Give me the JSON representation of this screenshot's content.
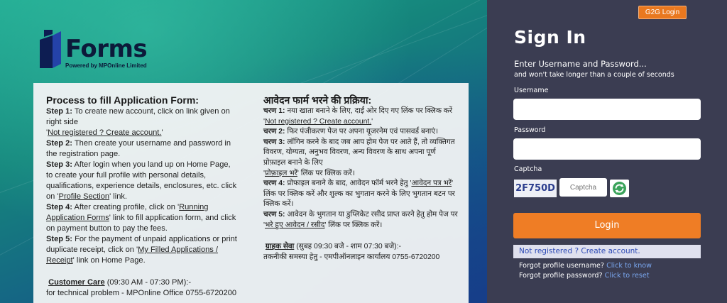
{
  "logo": {
    "text": "Forms",
    "tagline": "Powered by MPOnline Limited"
  },
  "colors": {
    "accent": "#ef7d25",
    "panel": "#3b3d52",
    "link": "#2c49b5"
  },
  "english": {
    "title": "Process to fill Application Form:",
    "step1_label": "Step 1:",
    "step1_text": " To create new account, click on link given on right side",
    "step1_link": "Not registered ? Create account.",
    "step2_label": "Step 2:",
    "step2_text": " Then create your username and password in the registration page.",
    "step3_label": "Step 3:",
    "step3_text": " After login when you land up on Home Page, to create your full profile with personal details, qualifications, experience details, enclosures, etc. click on ",
    "step3_link": "Profile Section",
    "step3_tail": " link.",
    "step4_label": "Step 4:",
    "step4_text": " After creating profile, click on ",
    "step4_link": "Running Application Forms",
    "step4_tail": " link to fill application form, and click on payment button to pay the fees.",
    "step5_label": "Step 5:",
    "step5_text": " For the payment of unpaid applications or print duplicate receipt, click on ",
    "step5_link": "My Filled Applications / Receipt",
    "step5_tail": " link on Home Page.",
    "care_title": "Customer Care",
    "care_hours": " (09:30 AM - 07:30 PM):-",
    "care_text": "for technical problem - MPOnline Office 0755-6720200"
  },
  "hindi": {
    "title": "आवेदन फार्म भरने की प्रक्रिया:",
    "s1_label": "चरण 1:",
    "s1_text": " नया खाता बनाने के लिए, दाईं ओर दिए गए लिंक पर क्लिक करें",
    "s1_link": "Not registered ? Create account.",
    "s2_label": "चरण 2:",
    "s2_text": " फिर पंजीकरण पेज पर अपना यूजरनेम एवं पासवर्ड बनाएं।",
    "s3_label": "चरण 3:",
    "s3_text": " लॉगिन करने के बाद जब आप होम पेज पर आते हैं, तो व्यक्तिगत विवरण, योग्यता, अनुभव विवरण, अन्य विवरण के साथ अपना पूर्ण प्रोफ़ाइल बनाने के लिए",
    "s3_link": "प्रोफ़ाइल भरें",
    "s3_tail": "' लिंक पर क्लिक करें।",
    "s4_label": "चरण 4:",
    "s4_text": " प्रोफाइल बनाने के बाद, आवेदन फॉर्म भरने हेतु '",
    "s4_link": "आवेदन पत्र भरें",
    "s4_tail": "' लिंक पर क्लिक करें और शुल्क का भुगतान करने के लिए भुगतान बटन पर क्लिक करें।",
    "s5_label": "चरण 5:",
    "s5_text": " आवेदन के भुगतान या डुप्लिकेट रसीद प्राप्त करने हेतु होम पेज पर",
    "s5_link": "भरे हुए आवेदन / रसीद",
    "s5_tail": "' लिंक पर क्लिक करें।",
    "care_title": "ग्राहक सेवा",
    "care_hours": " (सुबह 09:30 बजे - शाम 07:30 बजे):-",
    "care_text": "तकनीकी समस्या हेतु - एमपीऑनलाइन कार्यालय 0755-6720200"
  },
  "signin": {
    "g2g_label": "G2G Login",
    "title": "Sign In",
    "subtitle": "Enter Username and Password...",
    "subtitle2": "and won't take longer than a couple of seconds",
    "username_label": "Username",
    "username_value": "",
    "password_label": "Password",
    "password_value": "",
    "captcha_label": "Captcha",
    "captcha_code": "2F750D",
    "captcha_placeholder": "Captcha",
    "login_label": "Login",
    "register_link": "Not registered ? Create account.",
    "forgot_user_text": "Forgot profile username? ",
    "forgot_user_link": "Click to know",
    "forgot_pass_text": "Forgot profile password? ",
    "forgot_pass_link": "Click to reset"
  }
}
